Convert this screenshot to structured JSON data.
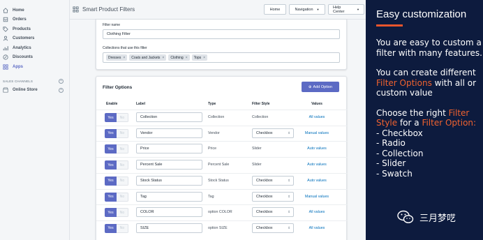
{
  "sidebar": {
    "items": [
      {
        "label": "Home",
        "icon": "home-icon"
      },
      {
        "label": "Orders",
        "icon": "orders-icon"
      },
      {
        "label": "Products",
        "icon": "tag-icon"
      },
      {
        "label": "Customers",
        "icon": "user-icon"
      },
      {
        "label": "Analytics",
        "icon": "chart-icon"
      },
      {
        "label": "Discounts",
        "icon": "discount-icon"
      },
      {
        "label": "Apps",
        "icon": "apps-icon"
      }
    ],
    "sales_channels_heading": "SALES CHANNELS",
    "online_store_label": "Online Store"
  },
  "header": {
    "app_title": "Smart Product Filters",
    "home_button": "Home",
    "navigation_button": "Navigation",
    "help_button": "Help Center"
  },
  "filter_form": {
    "name_label": "Filter name",
    "name_value": "Clothing Filter",
    "collections_label": "Collections that use this filter",
    "collections": [
      "Dresses",
      "Coats and Jackets",
      "Clothing",
      "Tops"
    ]
  },
  "filter_options": {
    "title": "Filter Options",
    "add_button": "Add Option",
    "columns": {
      "enable": "Enable",
      "label": "Label",
      "type": "Type",
      "style": "Filter Style",
      "values": "Values"
    },
    "toggle_yes": "Yes",
    "toggle_no": "No",
    "rows": [
      {
        "label": "Collection",
        "type": "Collection",
        "style": "Collection",
        "style_is_select": false,
        "values": "All values"
      },
      {
        "label": "Vendor",
        "type": "Vendor",
        "style": "Checkbox",
        "style_is_select": true,
        "values": "Manual values"
      },
      {
        "label": "Price",
        "type": "Price",
        "style": "Slider",
        "style_is_select": false,
        "values": "Auto values"
      },
      {
        "label": "Percent Sale",
        "type": "Percent Sale",
        "style": "Slider",
        "style_is_select": false,
        "values": "Auto values"
      },
      {
        "label": "Stock Status",
        "type": "Stock Status",
        "style": "Checkbox",
        "style_is_select": true,
        "values": "Auto values"
      },
      {
        "label": "Tag",
        "type": "Tag",
        "style": "Checkbox",
        "style_is_select": true,
        "values": "Manual values"
      },
      {
        "label": "COLOR",
        "type": "option COLOR",
        "style": "Checkbox",
        "style_is_select": true,
        "values": "All values"
      },
      {
        "label": "SIZE",
        "type": "option SIZE",
        "style": "Checkbox",
        "style_is_select": true,
        "values": "All values"
      }
    ]
  },
  "panel": {
    "title": "Easy customization",
    "para1": "You are easy to custom a filter with many features.",
    "para2_a": "You can create different ",
    "para2_hl": "Filter Options",
    "para2_b": " with all or custom value",
    "para3_a": "Choose the right ",
    "para3_hl1": "Filter Style",
    "para3_b": " for a ",
    "para3_hl2": "Filter Option:",
    "list": [
      "- Checkbox",
      "- Radio",
      "- Collection",
      "- Slider",
      "- Swatch"
    ],
    "watermark": "三月梦呓"
  },
  "colors": {
    "accent": "#5c6ac4",
    "panel_bg": "#0d1b3e",
    "highlight": "#f0622f",
    "link": "#006fbb"
  }
}
